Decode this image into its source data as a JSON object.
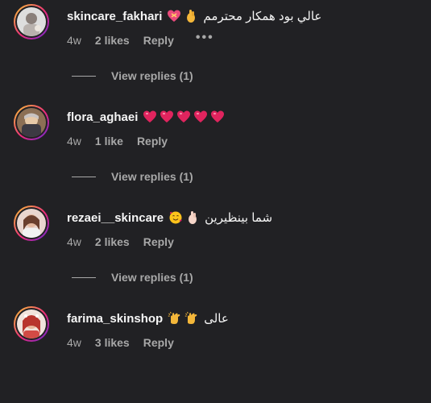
{
  "comments": [
    {
      "username": "skincare_fakhari",
      "emojis": [
        "heart-with-ribbon",
        "pinching-hand"
      ],
      "text": "عالي بود همکار محترمم",
      "time": "4w",
      "likes": "2 likes",
      "reply": "Reply",
      "more": "•••",
      "view_replies": "View replies (1)"
    },
    {
      "username": "flora_aghaei",
      "emojis": [
        "pink-heart",
        "pink-heart",
        "pink-heart",
        "pink-heart",
        "pink-heart"
      ],
      "text": "",
      "time": "4w",
      "likes": "1 like",
      "reply": "Reply",
      "view_replies": "View replies (1)"
    },
    {
      "username": "rezaei__skincare",
      "emojis": [
        "smiling-face-with-hearts",
        "pinching-hand"
      ],
      "text": "شما بینظیرین",
      "time": "4w",
      "likes": "2 likes",
      "reply": "Reply",
      "view_replies": "View replies (1)"
    },
    {
      "username": "farima_skinshop",
      "emojis": [
        "clapping-hands",
        "clapping-hands"
      ],
      "text": "عالی",
      "time": "4w",
      "likes": "3 likes",
      "reply": "Reply"
    }
  ],
  "colors": {
    "background": "#212124",
    "primary_text": "#f5f5f5",
    "secondary_text": "#a8a8a8",
    "heart": "#e0245e"
  }
}
